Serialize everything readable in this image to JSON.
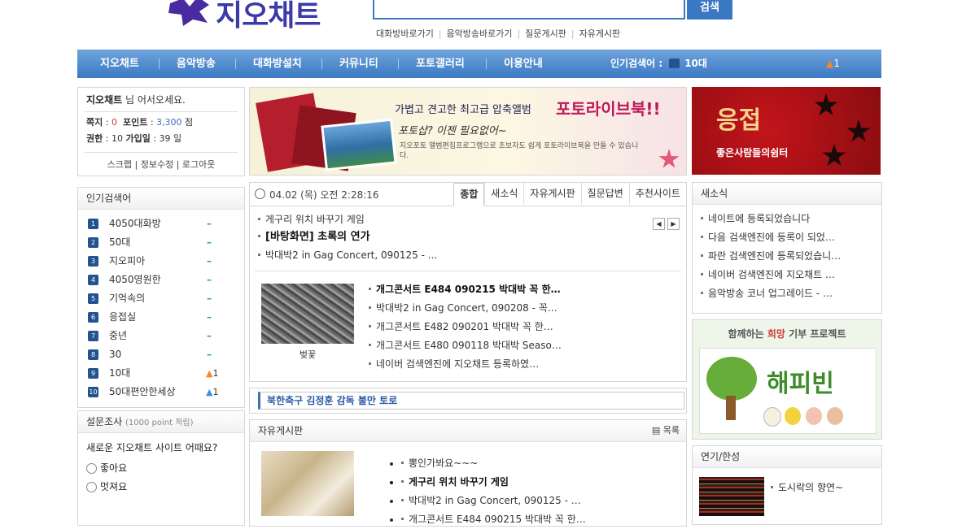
{
  "header": {
    "logo_text": "지오채트",
    "search_button": "검색",
    "top_links": [
      "대화방바로가기",
      "음악방송바로가기",
      "질문게시판",
      "자유게시판"
    ]
  },
  "nav": {
    "items": [
      "지오채트",
      "음악방송",
      "대화방설치",
      "커뮤니티",
      "포토갤러리",
      "이용안내"
    ],
    "popular_label": "인기검색어 :",
    "popular_value": "10대",
    "popular_change": "1"
  },
  "login": {
    "site": "지오채트",
    "greeting": " 님 어서오세요.",
    "note_label": "쪽지",
    "note_value": "0",
    "point_label": "포인트",
    "point_value": "3,300",
    "point_unit": "점",
    "grade_label": "권한",
    "grade_value": "10",
    "joined_label": "가입일",
    "joined_value": "39 일",
    "links": [
      "스크랩",
      "정보수정",
      "로그아웃"
    ]
  },
  "ranking": {
    "title": "인기검색어",
    "items": [
      {
        "no": "1",
        "label": "4050대화방",
        "change": "–"
      },
      {
        "no": "2",
        "label": "50대",
        "change": "–"
      },
      {
        "no": "3",
        "label": "지오피아",
        "change": "–"
      },
      {
        "no": "4",
        "label": "4050영원한",
        "change": "–"
      },
      {
        "no": "5",
        "label": "기억속의",
        "change": "–"
      },
      {
        "no": "6",
        "label": "응접실",
        "change": "–"
      },
      {
        "no": "7",
        "label": "중년",
        "change": "–"
      },
      {
        "no": "8",
        "label": "30",
        "change": "–"
      },
      {
        "no": "9",
        "label": "10대",
        "change": "▲1"
      },
      {
        "no": "10",
        "label": "50대편안한세상",
        "change": "▲1"
      }
    ]
  },
  "poll": {
    "title": "설문조사",
    "subtitle": "(1000 point 적립)",
    "question": "새로운 지오채트 사이트 어때요?",
    "options": [
      "좋아요",
      "멋져요"
    ]
  },
  "banner": {
    "line1": "가볍고 견고한 최고급 압축앨범",
    "brand": "포토라이브북!!",
    "line2": "포토샵? 이젠 필요없어~",
    "line3": "지오포토 앨범편집프로그램으로 초보자도 쉽게 포토라이브북을 만들 수 있습니다."
  },
  "ad_right": {
    "big": "응접",
    "small": "좋은사람들의쉼터"
  },
  "news": {
    "date": "04.02 (목) 오전 2:28:16",
    "tabs": [
      "종합",
      "새소식",
      "자유게시판",
      "질문답변",
      "추천사이트"
    ],
    "top_items": [
      "게구리 위치 바꾸기 게임",
      "[바탕화면] 초록의 연가",
      "박대박2 in Gag Concert, 090125 - ..."
    ],
    "thumb_caption": "벚꽃",
    "list_items": [
      "개그콘서트 E484 090215 박대박 꼭 한…",
      "박대박2 in Gag Concert, 090208 - 꼭…",
      "개그콘서트 E482 090201 박대박 꼭 한…",
      "개그콘서트 E480 090118 박대박 Seaso…",
      "네이버 검색엔진에 지오채트 등록하였…"
    ]
  },
  "ticker": {
    "text": "북한축구 김정훈 감독 불만 토로"
  },
  "board": {
    "title": "자유게시판",
    "more": "목록",
    "items": [
      "뽕인가봐요~~~",
      "게구리 위치 바꾸기 게임",
      "박대박2 in Gag Concert, 090125 - …",
      "개그콘서트 E484 090215 박대박 꼭 한…"
    ]
  },
  "notice": {
    "title": "새소식",
    "items": [
      "네이트에 등록되었습니다",
      "다음 검색엔진에 등록이 되었…",
      "파란 검색엔진에 등록되었습니…",
      "네이버 검색엔진에 지오채트 …",
      "음악방송 코너 업그레이드 - …"
    ]
  },
  "happy": {
    "prefix": "함께하는 ",
    "highlight": "희망",
    "suffix": " 기부 프로젝트",
    "logo_text": "해피빈"
  },
  "ent": {
    "title": "연기/한성",
    "item": "도시락의 향연~"
  },
  "colors": {
    "nav": "#3a79c2",
    "accent_red": "#d23a3a",
    "logo": "#3a3aa8"
  }
}
